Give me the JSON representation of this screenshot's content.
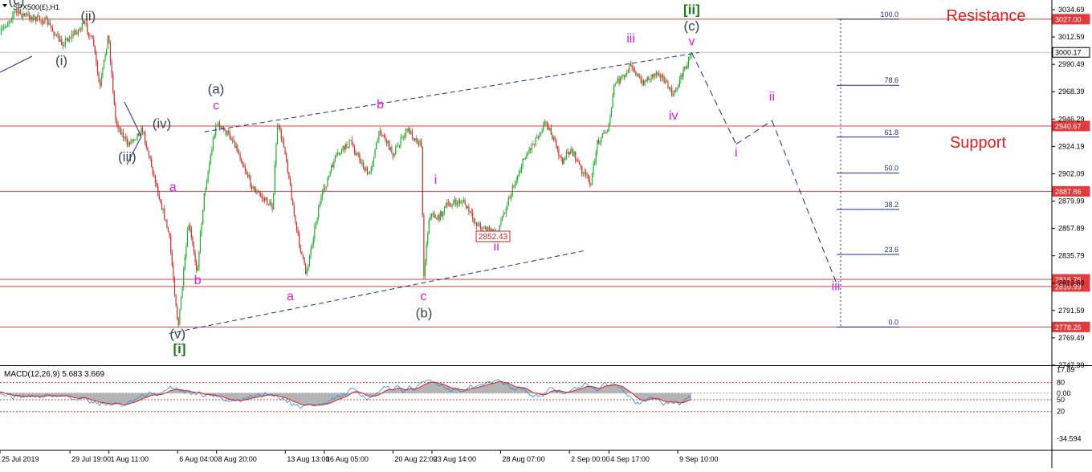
{
  "window": {
    "symbol_title": "SPX500(£),H1"
  },
  "annotations": {
    "resistance": "Resistance",
    "support": "Support",
    "low_marker": "2852.43"
  },
  "price_levels": [
    {
      "value": "3027.00",
      "price": 3027.0,
      "bg": "#e23b3b"
    },
    {
      "value": "3000.17",
      "price": 3000.17,
      "bg": "#ffffff"
    },
    {
      "value": "2940.67",
      "price": 2940.67,
      "bg": "#e23b3b"
    },
    {
      "value": "2887.86",
      "price": 2887.86,
      "bg": "#e23b3b"
    },
    {
      "value": "2816.76",
      "price": 2816.76,
      "bg": "#e23b3b"
    },
    {
      "value": "2810.99",
      "price": 2810.99,
      "bg": "#e23b3b"
    },
    {
      "value": "2778.26",
      "price": 2778.26,
      "bg": "#e23b3b"
    }
  ],
  "fibonacci": [
    {
      "label": "100.0",
      "price": 3027.0
    },
    {
      "label": "78.6",
      "price": 2973.6
    },
    {
      "label": "61.8",
      "price": 2931.7
    },
    {
      "label": "50.0",
      "price": 2902.6
    },
    {
      "label": "38.2",
      "price": 2873.3
    },
    {
      "label": "23.6",
      "price": 2836.9
    },
    {
      "label": "0.0",
      "price": 2778.26
    }
  ],
  "colors": {
    "up_candle": "#1fae2d",
    "down_candle": "#d0302f",
    "level_line": "#d84040",
    "trend_line": "#1a2c8c",
    "wave_grey": "#37474f",
    "wave_magenta": "#e020d8",
    "wave_green": "#1a7a1a",
    "macd_line": "#2a8ae0",
    "signal_line": "#d82020",
    "histogram": "#b4b4b4"
  },
  "wave_labels": [
    {
      "text": "(c)",
      "date": "26 Jul 2019 03:00",
      "price": 3039.0,
      "color": "grey"
    },
    {
      "text": "(ii)",
      "date": "31 Jul 2019 01:00",
      "price": 3026.0,
      "color": "grey"
    },
    {
      "text": "(i)",
      "date": "29 Jul 2019 05:00",
      "price": 2990.0,
      "color": "grey"
    },
    {
      "text": "(iv)",
      "date": "5 Aug 2019 02:00",
      "price": 2939.0,
      "color": "grey"
    },
    {
      "text": "(iii)",
      "date": "2 Aug 2019 17:00",
      "price": 2912.0,
      "color": "grey"
    },
    {
      "text": "(v)",
      "date": "6 Aug 2019 04:00",
      "price": 2769.0,
      "color": "grey"
    },
    {
      "text": "[i]",
      "date": "6 Aug 2019 07:00",
      "price": 2757.0,
      "color": "green"
    },
    {
      "text": "(a)",
      "date": "8 Aug 2019 19:00",
      "price": 2967.0,
      "color": "grey"
    },
    {
      "text": "c",
      "date": "8 Aug 2019 19:00",
      "price": 2954.0,
      "color": "magenta"
    },
    {
      "text": "a",
      "date": "5 Aug 2019 20:00",
      "price": 2888.0,
      "color": "magenta"
    },
    {
      "text": "b",
      "date": "7 Aug 2019 13:00",
      "price": 2813.0,
      "color": "magenta"
    },
    {
      "text": "a",
      "date": "13 Aug 2019 21:00",
      "price": 2800.0,
      "color": "magenta"
    },
    {
      "text": "b",
      "date": "20 Aug 2019 01:00",
      "price": 2955.0,
      "color": "magenta"
    },
    {
      "text": "c",
      "date": "23 Aug 2019 00:00",
      "price": 2800.0,
      "color": "magenta"
    },
    {
      "text": "(b)",
      "date": "23 Aug 2019 01:00",
      "price": 2786.0,
      "color": "grey"
    },
    {
      "text": "i",
      "date": "23 Aug 2019 20:00",
      "price": 2894.0,
      "color": "magenta"
    },
    {
      "text": "ii",
      "date": "28 Aug 2019 00:00",
      "price": 2840.0,
      "color": "magenta"
    },
    {
      "text": "iii",
      "date": "6 Sep 2019 05:00",
      "price": 3008.0,
      "color": "magenta"
    },
    {
      "text": "iv",
      "date": "9 Sep 2019 03:00",
      "price": 2946.0,
      "color": "magenta"
    },
    {
      "text": "v",
      "date": "10 Sep 2019 09:00",
      "price": 3006.0,
      "color": "magenta"
    },
    {
      "text": "(c)",
      "date": "10 Sep 2019 09:00",
      "price": 3018.0,
      "color": "grey"
    },
    {
      "text": "[ii]",
      "date": "10 Sep 2019 09:00",
      "price": 3031.0,
      "color": "green"
    },
    {
      "text": "i",
      "date": "13 Sep 2019 10:00",
      "price": 2916.0,
      "color": "magenta"
    },
    {
      "text": "ii",
      "date": "15 Sep 2019 21:00",
      "price": 2961.0,
      "color": "magenta"
    },
    {
      "text": "iii",
      "date": "20 Sep 2019 06:00",
      "price": 2808.0,
      "color": "magenta"
    }
  ],
  "chart_data": [
    {
      "type": "candlestick",
      "title": "SPX500(£),H1",
      "yunit": "price",
      "ylim": [
        2747.99,
        3039.9
      ],
      "yticks": [
        3034.69,
        3012.59,
        2990.49,
        2968.39,
        2946.29,
        2924.19,
        2902.09,
        2879.99,
        2857.89,
        2835.79,
        2813.69,
        2791.59,
        2769.49,
        2747.39
      ],
      "ytick_labels": [
        "3034.69",
        "3012.59",
        "2990.49",
        "2968.39",
        "2946.29",
        "2924.19",
        "2902.09",
        "2879.99",
        "2857.89",
        "2835.79",
        "2813.69",
        "2791.59",
        "2769.49",
        "2747.39"
      ],
      "xtick_labels": [
        "25 Jul 2019",
        "29 Jul 19:00",
        "1 Aug 11:00",
        "6 Aug 04:00",
        "8 Aug 20:00",
        "13 Aug 13:00",
        "16 Aug 05:00",
        "20 Aug 22:00",
        "23 Aug 14:00",
        "28 Aug 07:00",
        "2 Sep 00:00",
        "4 Sep 17:00",
        "9 Sep 10:00"
      ],
      "xtick_dates": [
        "25 Jul 2019 00:00",
        "29 Jul 2019 19:00",
        "1 Aug 2019 11:00",
        "6 Aug 2019 04:00",
        "8 Aug 2019 20:00",
        "13 Aug 2019 13:00",
        "16 Aug 2019 05:00",
        "20 Aug 2019 22:00",
        "23 Aug 2019 14:00",
        "28 Aug 2019 07:00",
        "2 Sep 2019 00:00",
        "4 Sep 2019 17:00",
        "9 Sep 2019 10:00"
      ],
      "price_path": [
        {
          "date": "25 Jul 2019 00:00",
          "price": 3015
        },
        {
          "date": "26 Jul 2019 00:00",
          "price": 3033
        },
        {
          "date": "26 Jul 2019 18:00",
          "price": 3030
        },
        {
          "date": "28 Jul 2019 05:00",
          "price": 3025
        },
        {
          "date": "29 Jul 2019 05:00",
          "price": 3007
        },
        {
          "date": "30 Jul 2019 20:00",
          "price": 3023
        },
        {
          "date": "31 Jul 2019 10:00",
          "price": 3006
        },
        {
          "date": "31 Jul 2019 20:00",
          "price": 2970
        },
        {
          "date": "1 Aug 2019 10:00",
          "price": 3015
        },
        {
          "date": "1 Aug 2019 22:00",
          "price": 2945
        },
        {
          "date": "2 Aug 2019 17:00",
          "price": 2926
        },
        {
          "date": "3 Aug 2019 18:00",
          "price": 2938
        },
        {
          "date": "5 Aug 2019 14:00",
          "price": 2852
        },
        {
          "date": "6 Aug 2019 05:00",
          "price": 2778
        },
        {
          "date": "6 Aug 2019 22:00",
          "price": 2862
        },
        {
          "date": "7 Aug 2019 12:00",
          "price": 2823
        },
        {
          "date": "7 Aug 2019 23:00",
          "price": 2883
        },
        {
          "date": "8 Aug 2019 19:00",
          "price": 2943
        },
        {
          "date": "9 Aug 2019 23:00",
          "price": 2930
        },
        {
          "date": "11 Aug 2019 08:00",
          "price": 2890
        },
        {
          "date": "12 Aug 2019 16:00",
          "price": 2875
        },
        {
          "date": "13 Aug 2019 00:00",
          "price": 2942
        },
        {
          "date": "13 Aug 2019 13:00",
          "price": 2920
        },
        {
          "date": "14 Aug 2019 06:00",
          "price": 2860
        },
        {
          "date": "14 Aug 2019 23:00",
          "price": 2821
        },
        {
          "date": "15 Aug 2019 21:00",
          "price": 2878
        },
        {
          "date": "16 Aug 2019 23:00",
          "price": 2915
        },
        {
          "date": "18 Aug 2019 00:00",
          "price": 2928
        },
        {
          "date": "19 Aug 2019 06:00",
          "price": 2900
        },
        {
          "date": "20 Aug 2019 01:00",
          "price": 2938
        },
        {
          "date": "20 Aug 2019 22:00",
          "price": 2918
        },
        {
          "date": "21 Aug 2019 22:00",
          "price": 2938
        },
        {
          "date": "22 Aug 2019 21:00",
          "price": 2925
        },
        {
          "date": "23 Aug 2019 00:00",
          "price": 2818
        },
        {
          "date": "23 Aug 2019 10:00",
          "price": 2870
        },
        {
          "date": "24 Aug 2019 00:00",
          "price": 2866
        },
        {
          "date": "24 Aug 2019 16:00",
          "price": 2877
        },
        {
          "date": "25 Aug 2019 17:00",
          "price": 2880
        },
        {
          "date": "26 Aug 2019 14:00",
          "price": 2862
        },
        {
          "date": "28 Aug 2019 00:00",
          "price": 2853
        },
        {
          "date": "28 Aug 2019 16:00",
          "price": 2876
        },
        {
          "date": "29 Aug 2019 22:00",
          "price": 2915
        },
        {
          "date": "31 Aug 2019 10:00",
          "price": 2945
        },
        {
          "date": "1 Sep 2019 11:00",
          "price": 2912
        },
        {
          "date": "2 Sep 2019 03:00",
          "price": 2922
        },
        {
          "date": "2 Sep 2019 23:00",
          "price": 2902
        },
        {
          "date": "3 Sep 2019 12:00",
          "price": 2895
        },
        {
          "date": "3 Sep 2019 22:00",
          "price": 2928
        },
        {
          "date": "4 Sep 2019 17:00",
          "price": 2940
        },
        {
          "date": "5 Sep 2019 02:00",
          "price": 2975
        },
        {
          "date": "5 Sep 2019 22:00",
          "price": 2982
        },
        {
          "date": "6 Sep 2019 05:00",
          "price": 2992
        },
        {
          "date": "6 Sep 2019 22:00",
          "price": 2975
        },
        {
          "date": "8 Sep 2019 02:00",
          "price": 2985
        },
        {
          "date": "9 Sep 2019 03:00",
          "price": 2965
        },
        {
          "date": "9 Sep 2019 19:00",
          "price": 2985
        },
        {
          "date": "10 Sep 2019 09:00",
          "price": 3000
        }
      ],
      "projection_path": [
        {
          "date": "10 Sep 2019 09:00",
          "price": 3000
        },
        {
          "date": "13 Sep 2019 10:00",
          "price": 2926
        },
        {
          "date": "15 Sep 2019 21:00",
          "price": 2945
        },
        {
          "date": "20 Sep 2019 06:00",
          "price": 2815
        }
      ],
      "channel_upper": [
        {
          "date": "8 Aug 2019 00:00",
          "price": 2936.0
        },
        {
          "date": "10 Sep 2019 21:00",
          "price": 3000.0
        }
      ],
      "channel_lower": [
        {
          "date": "5 Aug 2019 14:00",
          "price": 2773.0
        },
        {
          "date": "3 Sep 2019 02:00",
          "price": 2840.0
        }
      ]
    },
    {
      "type": "line",
      "title": "MACD(12,26,9) 5.683 3.669",
      "series": [
        {
          "name": "MACD",
          "values": [
            5.683
          ]
        },
        {
          "name": "Signal",
          "values": [
            3.669
          ]
        }
      ],
      "ytick_labels": [
        "17.89",
        "80",
        "0.00",
        "50",
        "20",
        "-34.594"
      ],
      "ytick_values": [
        17.89,
        8.0,
        0.0,
        -5.0,
        -14.0,
        -34.594
      ],
      "ylim": [
        -38.0,
        20.0
      ],
      "reference_levels": [
        8.0,
        0.0,
        -5.0,
        -14.0
      ]
    }
  ]
}
